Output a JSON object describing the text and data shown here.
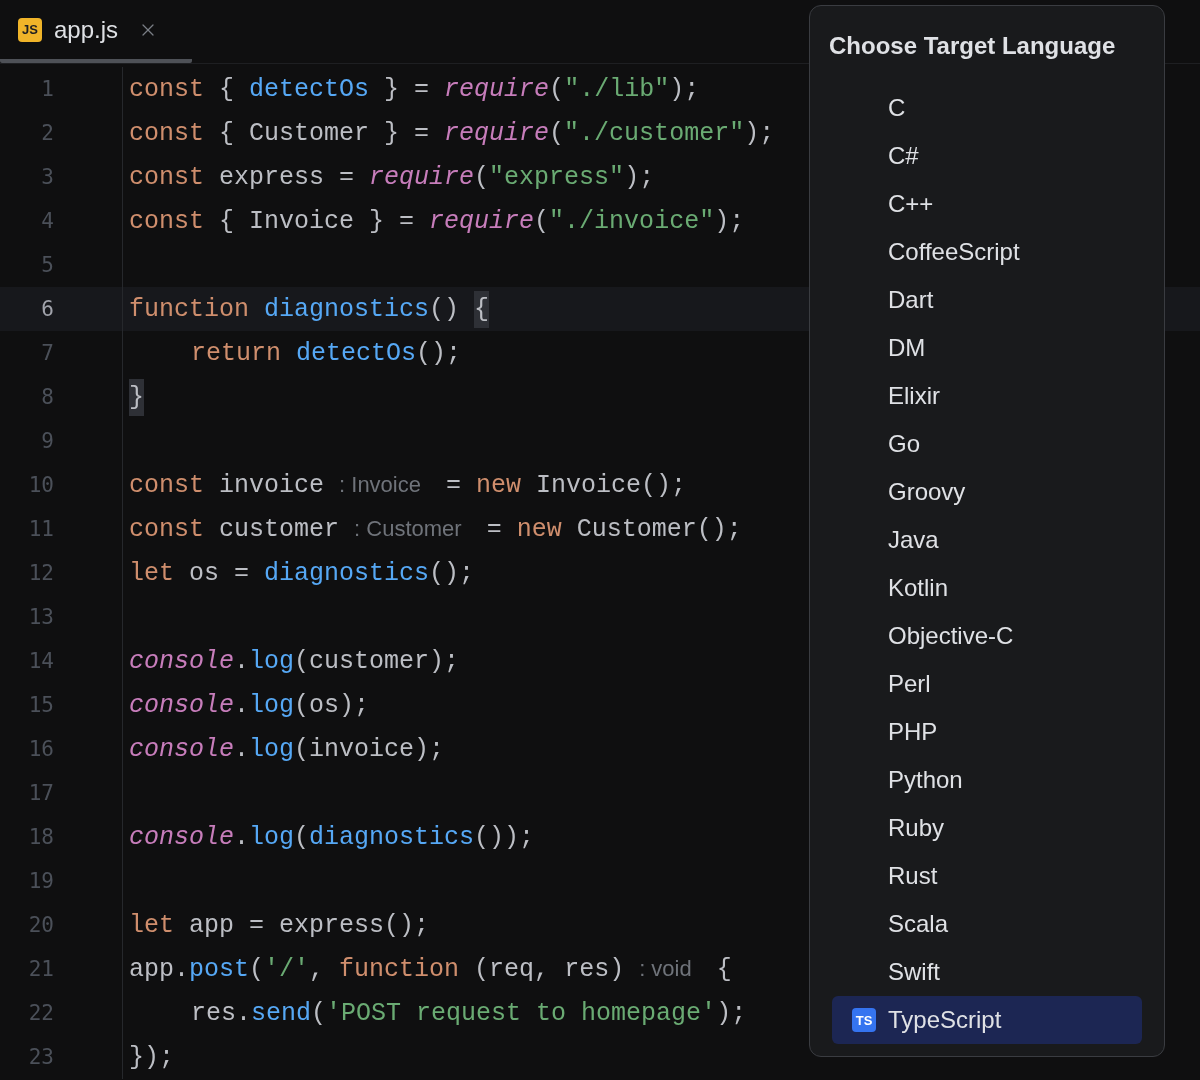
{
  "tab": {
    "icon_text": "JS",
    "label": "app.js",
    "selected": true
  },
  "editor": {
    "lines": [
      {
        "number": "1",
        "current": false,
        "tokens": [
          {
            "kind": "kw",
            "text": "const"
          },
          {
            "kind": "plain",
            "text": " { "
          },
          {
            "kind": "fn",
            "text": "detectOs"
          },
          {
            "kind": "plain",
            "text": " } = "
          },
          {
            "kind": "special",
            "text": "require"
          },
          {
            "kind": "plain",
            "text": "("
          },
          {
            "kind": "str",
            "text": "\"./lib\""
          },
          {
            "kind": "plain",
            "text": ");"
          }
        ]
      },
      {
        "number": "2",
        "current": false,
        "tokens": [
          {
            "kind": "kw",
            "text": "const"
          },
          {
            "kind": "plain",
            "text": " { Customer } = "
          },
          {
            "kind": "special",
            "text": "require"
          },
          {
            "kind": "plain",
            "text": "("
          },
          {
            "kind": "str",
            "text": "\"./customer\""
          },
          {
            "kind": "plain",
            "text": ");"
          }
        ]
      },
      {
        "number": "3",
        "current": false,
        "tokens": [
          {
            "kind": "kw",
            "text": "const"
          },
          {
            "kind": "plain",
            "text": " express = "
          },
          {
            "kind": "special",
            "text": "require"
          },
          {
            "kind": "plain",
            "text": "("
          },
          {
            "kind": "str",
            "text": "\"express\""
          },
          {
            "kind": "plain",
            "text": ");"
          }
        ]
      },
      {
        "number": "4",
        "current": false,
        "tokens": [
          {
            "kind": "kw",
            "text": "const"
          },
          {
            "kind": "plain",
            "text": " { Invoice } = "
          },
          {
            "kind": "special",
            "text": "require"
          },
          {
            "kind": "plain",
            "text": "("
          },
          {
            "kind": "str",
            "text": "\"./invoice\""
          },
          {
            "kind": "plain",
            "text": ");"
          }
        ]
      },
      {
        "number": "5",
        "current": false
      },
      {
        "number": "6",
        "current": true,
        "tokens": [
          {
            "kind": "kw",
            "text": "function "
          },
          {
            "kind": "fn",
            "text": "diagnostics"
          },
          {
            "kind": "plain",
            "text": "() "
          },
          {
            "kind": "brace",
            "text": "{"
          }
        ],
        "children": [
          {
            "number": "7",
            "current": false,
            "tokens": [
              {
                "kind": "kw",
                "text": "return "
              },
              {
                "kind": "fn",
                "text": "detectOs"
              },
              {
                "kind": "plain",
                "text": "();"
              }
            ]
          }
        ]
      },
      {
        "number": "8",
        "current": false,
        "tokens": [
          {
            "kind": "brace",
            "text": "}"
          }
        ]
      },
      {
        "number": "9",
        "current": false
      },
      {
        "number": "10",
        "current": false,
        "tokens": [
          {
            "kind": "kw",
            "text": "const"
          },
          {
            "kind": "plain",
            "text": " invoice "
          },
          {
            "kind": "hint",
            "text": ": Invoice"
          },
          {
            "kind": "plain",
            "text": " = "
          },
          {
            "kind": "kw",
            "text": "new"
          },
          {
            "kind": "plain",
            "text": " Invoice();"
          }
        ]
      },
      {
        "number": "11",
        "current": false,
        "tokens": [
          {
            "kind": "kw",
            "text": "const"
          },
          {
            "kind": "plain",
            "text": " customer "
          },
          {
            "kind": "hint",
            "text": ": Customer"
          },
          {
            "kind": "plain",
            "text": " = "
          },
          {
            "kind": "kw",
            "text": "new"
          },
          {
            "kind": "plain",
            "text": " Customer();"
          }
        ]
      },
      {
        "number": "12",
        "current": false,
        "tokens": [
          {
            "kind": "kw",
            "text": "let"
          },
          {
            "kind": "plain",
            "text": " os = "
          },
          {
            "kind": "fn",
            "text": "diagnostics"
          },
          {
            "kind": "plain",
            "text": "();"
          }
        ]
      },
      {
        "number": "13",
        "current": false
      },
      {
        "number": "14",
        "current": false,
        "tokens": [
          {
            "kind": "special",
            "text": "console"
          },
          {
            "kind": "plain",
            "text": "."
          },
          {
            "kind": "fn",
            "text": "log"
          },
          {
            "kind": "plain",
            "text": "(customer);"
          }
        ]
      },
      {
        "number": "15",
        "current": false,
        "tokens": [
          {
            "kind": "special",
            "text": "console"
          },
          {
            "kind": "plain",
            "text": "."
          },
          {
            "kind": "fn",
            "text": "log"
          },
          {
            "kind": "plain",
            "text": "(os);"
          }
        ]
      },
      {
        "number": "16",
        "current": false,
        "tokens": [
          {
            "kind": "special",
            "text": "console"
          },
          {
            "kind": "plain",
            "text": "."
          },
          {
            "kind": "fn",
            "text": "log"
          },
          {
            "kind": "plain",
            "text": "(invoice);"
          }
        ]
      },
      {
        "number": "17",
        "current": false
      },
      {
        "number": "18",
        "current": false,
        "tokens": [
          {
            "kind": "special",
            "text": "console"
          },
          {
            "kind": "plain",
            "text": "."
          },
          {
            "kind": "fn",
            "text": "log"
          },
          {
            "kind": "plain",
            "text": "("
          },
          {
            "kind": "fn",
            "text": "diagnostics"
          },
          {
            "kind": "plain",
            "text": "());"
          }
        ]
      },
      {
        "number": "19",
        "current": false
      },
      {
        "number": "20",
        "current": false,
        "tokens": [
          {
            "kind": "kw",
            "text": "let"
          },
          {
            "kind": "plain",
            "text": " app = express();"
          }
        ]
      },
      {
        "number": "21",
        "current": false,
        "tokens": [
          {
            "kind": "plain",
            "text": "app."
          },
          {
            "kind": "fn",
            "text": "post"
          },
          {
            "kind": "plain",
            "text": "("
          },
          {
            "kind": "str",
            "text": "'/'"
          },
          {
            "kind": "plain",
            "text": ", "
          },
          {
            "kind": "kw",
            "text": "function"
          },
          {
            "kind": "plain",
            "text": " (req, res) "
          },
          {
            "kind": "hint",
            "text": ": void"
          },
          {
            "kind": "plain",
            "text": " {"
          }
        ],
        "children": [
          {
            "number": "22",
            "current": false,
            "tokens": [
              {
                "kind": "plain",
                "text": "res."
              },
              {
                "kind": "fn",
                "text": "send"
              },
              {
                "kind": "plain",
                "text": "("
              },
              {
                "kind": "str",
                "text": "'POST request to homepage'"
              },
              {
                "kind": "plain",
                "text": ");"
              }
            ]
          }
        ]
      },
      {
        "number": "23",
        "current": false,
        "tokens": [
          {
            "kind": "plain",
            "text": "});"
          }
        ]
      }
    ]
  },
  "popup": {
    "title": "Choose Target Language",
    "items": [
      {
        "label": "C",
        "selected": false
      },
      {
        "label": "C#",
        "selected": false
      },
      {
        "label": "C++",
        "selected": false
      },
      {
        "label": "CoffeeScript",
        "selected": false
      },
      {
        "label": "Dart",
        "selected": false
      },
      {
        "label": "DM",
        "selected": false
      },
      {
        "label": "Elixir",
        "selected": false
      },
      {
        "label": "Go",
        "selected": false
      },
      {
        "label": "Groovy",
        "selected": false
      },
      {
        "label": "Java",
        "selected": false
      },
      {
        "label": "Kotlin",
        "selected": false
      },
      {
        "label": "Objective-C",
        "selected": false
      },
      {
        "label": "Perl",
        "selected": false
      },
      {
        "label": "PHP",
        "selected": false
      },
      {
        "label": "Python",
        "selected": false
      },
      {
        "label": "Ruby",
        "selected": false
      },
      {
        "label": "Rust",
        "selected": false
      },
      {
        "label": "Scala",
        "selected": false
      },
      {
        "label": "Swift",
        "selected": false
      },
      {
        "label": "TypeScript",
        "selected": true,
        "icon_text": "TS"
      }
    ]
  }
}
